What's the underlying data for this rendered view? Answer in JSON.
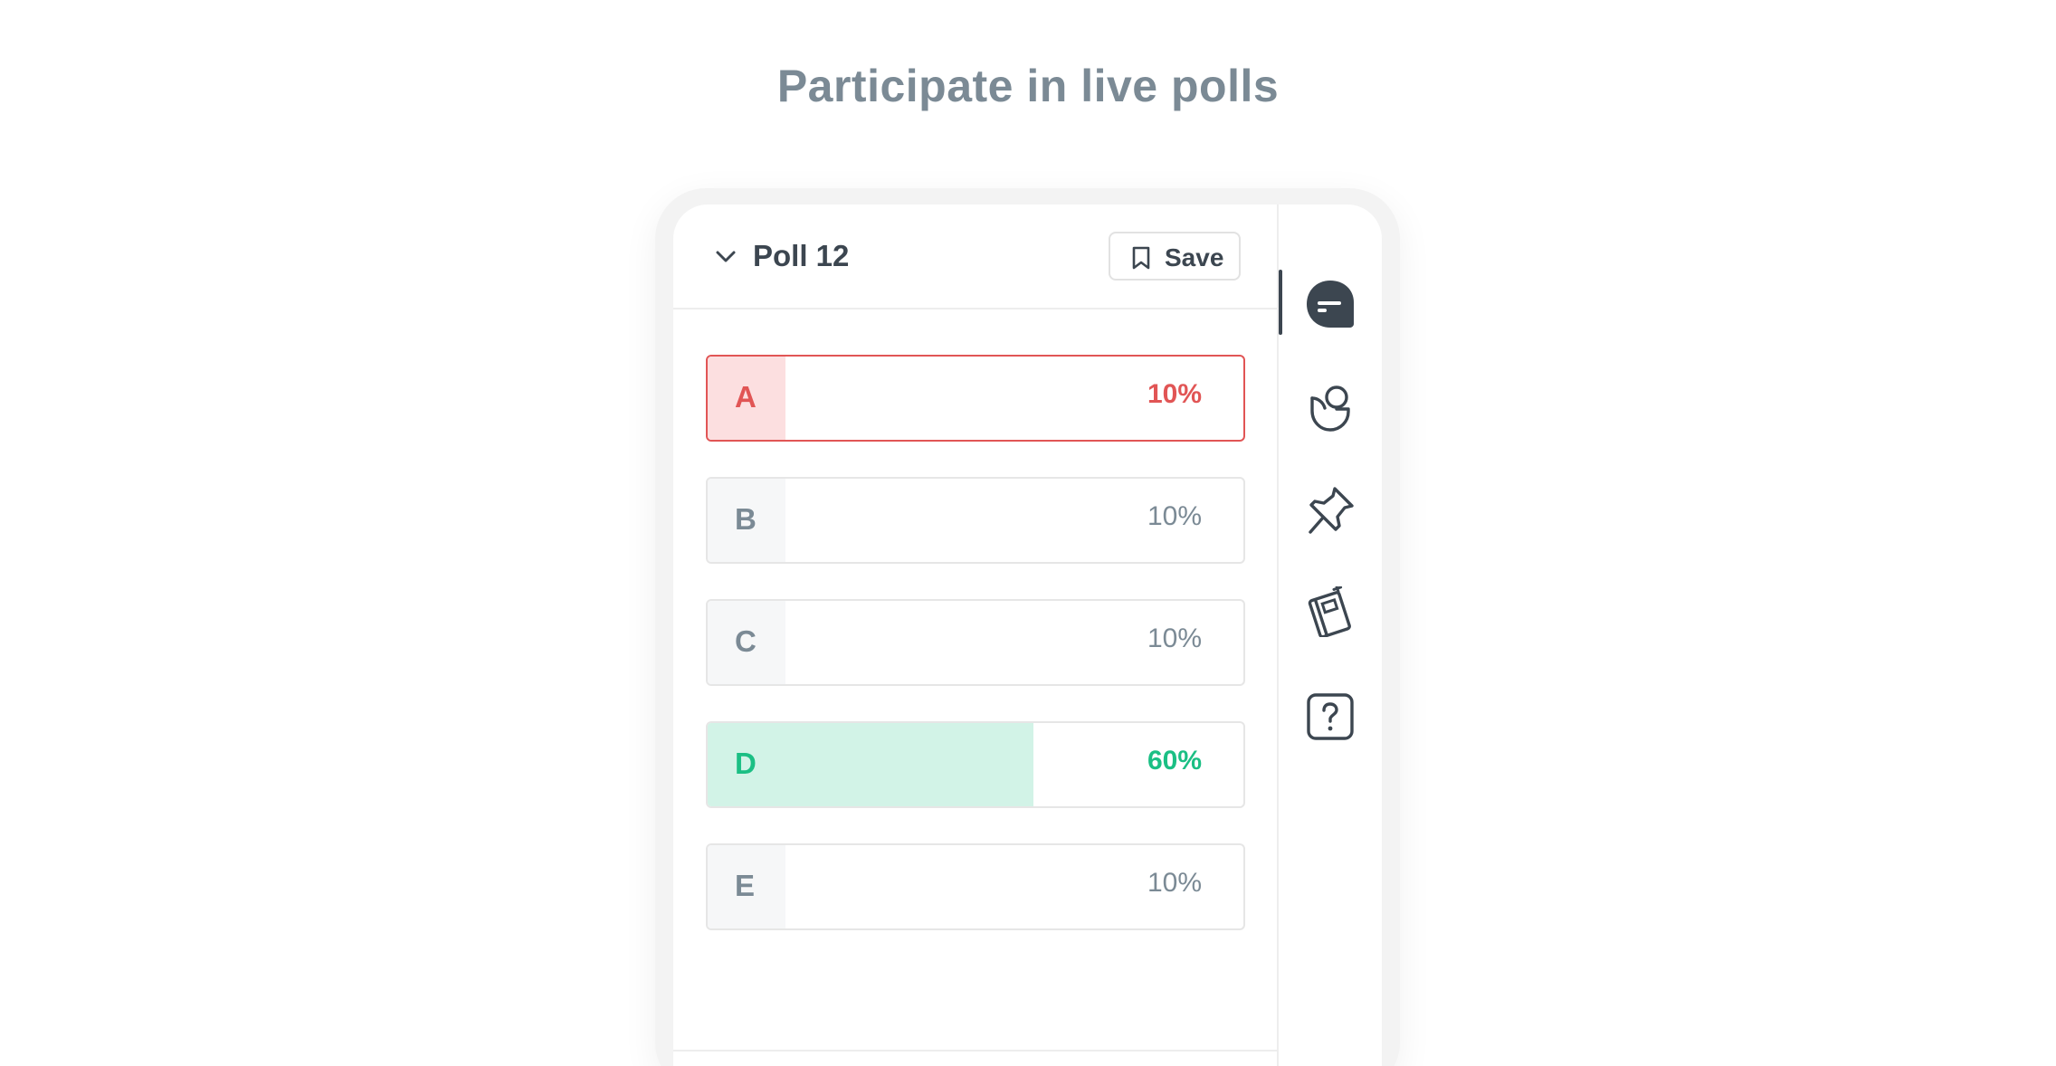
{
  "headline": "Participate in live polls",
  "poll": {
    "title": "Poll 12",
    "save_label": "Save",
    "options": [
      {
        "letter": "A",
        "percent_label": "10%",
        "percent": 10,
        "state": "selected"
      },
      {
        "letter": "B",
        "percent_label": "10%",
        "percent": 10,
        "state": "default"
      },
      {
        "letter": "C",
        "percent_label": "10%",
        "percent": 10,
        "state": "default"
      },
      {
        "letter": "D",
        "percent_label": "60%",
        "percent": 60,
        "state": "winner"
      },
      {
        "letter": "E",
        "percent_label": "10%",
        "percent": 10,
        "state": "default"
      }
    ]
  },
  "side_rail": {
    "items": [
      {
        "icon": "chat-bubble-icon",
        "active": true
      },
      {
        "icon": "poll-icon",
        "active": false
      },
      {
        "icon": "pin-icon",
        "active": false
      },
      {
        "icon": "notebook-icon",
        "active": false
      },
      {
        "icon": "question-icon",
        "active": false
      }
    ]
  },
  "colors": {
    "headline": "#7b8a95",
    "selected": "#e15555",
    "selected_fill": "#fcdfe0",
    "winner": "#1bbf84",
    "winner_fill": "#d2f3e7",
    "dark": "#3c4650"
  }
}
